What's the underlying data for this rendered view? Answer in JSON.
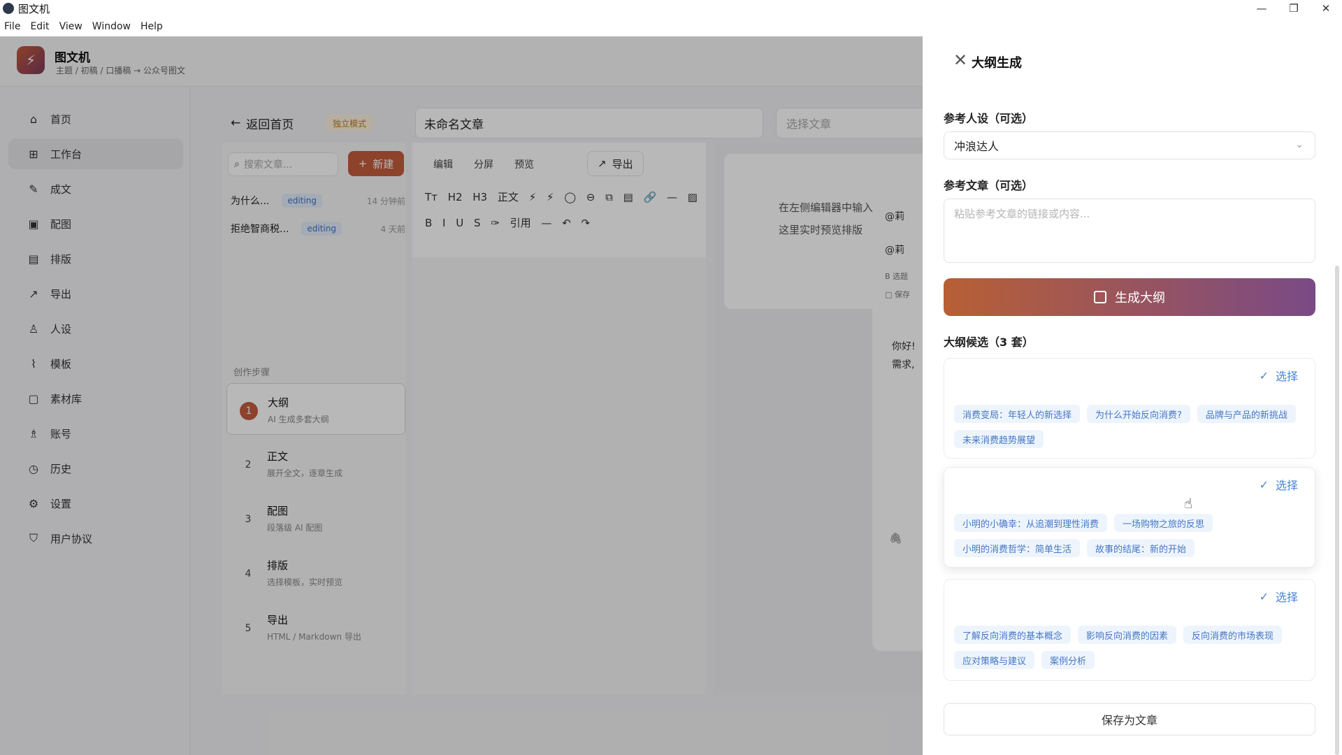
{
  "window": {
    "title": "图文机",
    "controls": [
      "—",
      "❐",
      "✕"
    ]
  },
  "menu": [
    "File",
    "Edit",
    "View",
    "Window",
    "Help"
  ],
  "header": {
    "app_name": "图文机",
    "breadcrumb": "主题 / 初稿 / 口播稿 → 公众号图文"
  },
  "sidebar": {
    "items": [
      {
        "label": "首页",
        "icon": "home-icon",
        "glyph": "⌂"
      },
      {
        "label": "工作台",
        "icon": "grid-icon",
        "glyph": "⊞"
      },
      {
        "label": "成文",
        "icon": "pen-icon",
        "glyph": "✎"
      },
      {
        "label": "配图",
        "icon": "image-icon",
        "glyph": "▣"
      },
      {
        "label": "排版",
        "icon": "layout-icon",
        "glyph": "▤"
      },
      {
        "label": "导出",
        "icon": "export-icon",
        "glyph": "↗"
      },
      {
        "label": "人设",
        "icon": "user-icon",
        "glyph": "♙"
      },
      {
        "label": "模板",
        "icon": "template-icon",
        "glyph": "⌇"
      },
      {
        "label": "素材库",
        "icon": "file-icon",
        "glyph": "▢"
      },
      {
        "label": "账号",
        "icon": "account-icon",
        "glyph": "♗"
      },
      {
        "label": "历史",
        "icon": "clock-icon",
        "glyph": "◷"
      },
      {
        "label": "设置",
        "icon": "gear-icon",
        "glyph": "⚙"
      },
      {
        "label": "用户协议",
        "icon": "shield-icon",
        "glyph": "⛉"
      }
    ]
  },
  "topbar": {
    "back_label": "返回首页",
    "mode_badge": "独立模式",
    "article_title": "未命名文章",
    "select_article_placeholder": "选择文章"
  },
  "doclist": {
    "search_placeholder": "搜索文章...",
    "new_label": "新建",
    "items": [
      {
        "title": "为什么...",
        "status": "editing",
        "time": "14 分钟前"
      },
      {
        "title": "拒绝智商税...",
        "status": "editing",
        "time": "4 天前"
      }
    ]
  },
  "steps": {
    "title": "创作步骤",
    "items": [
      {
        "num": "1",
        "title": "大纲",
        "sub": "AI 生成多套大纲"
      },
      {
        "num": "2",
        "title": "正文",
        "sub": "展开全文，逐章生成"
      },
      {
        "num": "3",
        "title": "配图",
        "sub": "段落级 AI 配图"
      },
      {
        "num": "4",
        "title": "排版",
        "sub": "选择模板，实时预览"
      },
      {
        "num": "5",
        "title": "导出",
        "sub": "HTML / Markdown 导出"
      }
    ]
  },
  "editor": {
    "tabs": [
      "编辑",
      "分屏",
      "预览"
    ],
    "export_label": "导出",
    "toolbar": "Tт H2 H3 正文 ⚡ ⚡ ◯ ⊖ ⧉ ▤ 🔗 — ▨ B I U S ✑ 引用 — ↶ ↷"
  },
  "preview": {
    "line1": "在左侧编辑器中输入",
    "line2": "这里实时预览排版",
    "phone_items": [
      "@莉",
      "@莉",
      "B 选题",
      "□ 保存"
    ],
    "phone_msg1": "你好!",
    "phone_msg2": "需求,"
  },
  "drawer": {
    "title": "大纲生成",
    "persona_label": "参考人设（可选）",
    "persona_value": "冲浪达人",
    "ref_label": "参考文章（可选）",
    "ref_placeholder": "粘贴参考文章的链接或内容...",
    "generate_label": "生成大纲",
    "candidates_label": "大纲候选（3 套）",
    "choose_label": "选择",
    "candidates": [
      {
        "chips": [
          "消费变局：年轻人的新选择",
          "为什么开始反向消费?",
          "品牌与产品的新挑战",
          "未来消费趋势展望"
        ]
      },
      {
        "chips": [
          "小明的小确幸：从追潮到理性消费",
          "一场购物之旅的反思",
          "小明的消费哲学：简单生活",
          "故事的结尾：新的开始"
        ]
      },
      {
        "chips": [
          "了解反向消费的基本概念",
          "影响反向消费的因素",
          "反向消费的市场表现",
          "应对策略与建议",
          "案例分析"
        ]
      }
    ],
    "save_label": "保存为文章"
  },
  "colors": {
    "accent": "#c45c3d",
    "gradient_end": "#7a4a86",
    "chip_text": "#4478c4",
    "chip_bg": "#eef4fc",
    "select_text": "#4a84d9"
  }
}
